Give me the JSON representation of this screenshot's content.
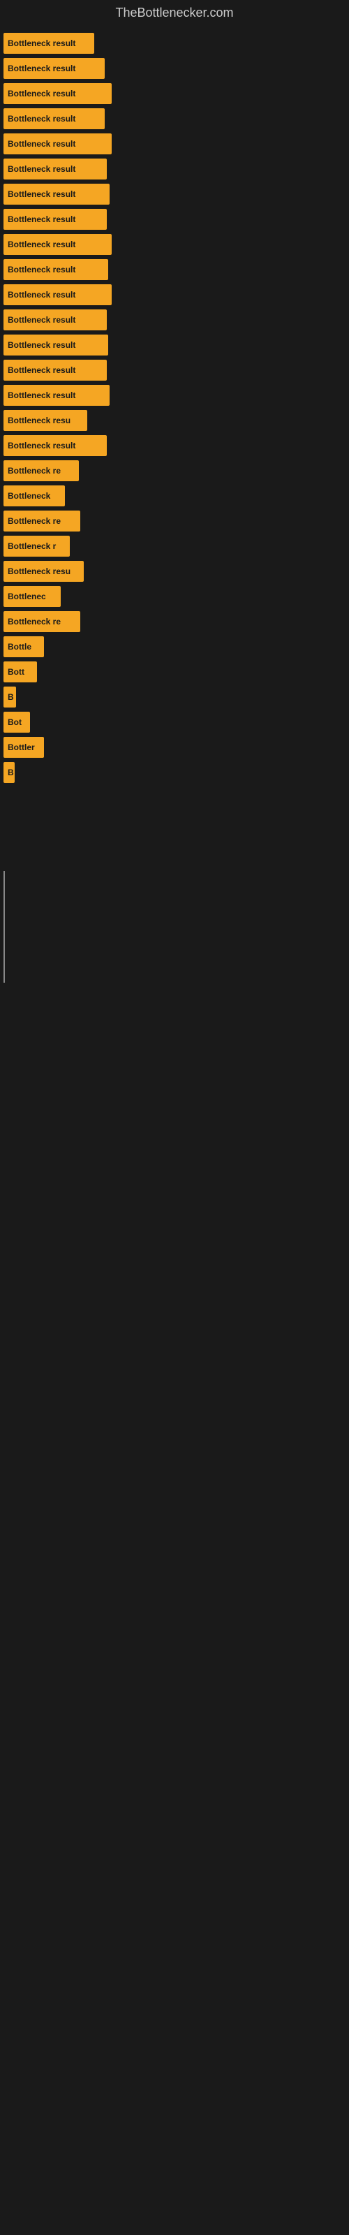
{
  "site": {
    "title": "TheBottlenecker.com"
  },
  "bars": [
    {
      "id": 1,
      "label": "Bottleneck result",
      "class": "bar-1"
    },
    {
      "id": 2,
      "label": "Bottleneck result",
      "class": "bar-2"
    },
    {
      "id": 3,
      "label": "Bottleneck result",
      "class": "bar-3"
    },
    {
      "id": 4,
      "label": "Bottleneck result",
      "class": "bar-4"
    },
    {
      "id": 5,
      "label": "Bottleneck result",
      "class": "bar-5"
    },
    {
      "id": 6,
      "label": "Bottleneck result",
      "class": "bar-6"
    },
    {
      "id": 7,
      "label": "Bottleneck result",
      "class": "bar-7"
    },
    {
      "id": 8,
      "label": "Bottleneck result",
      "class": "bar-8"
    },
    {
      "id": 9,
      "label": "Bottleneck result",
      "class": "bar-9"
    },
    {
      "id": 10,
      "label": "Bottleneck result",
      "class": "bar-10"
    },
    {
      "id": 11,
      "label": "Bottleneck result",
      "class": "bar-11"
    },
    {
      "id": 12,
      "label": "Bottleneck result",
      "class": "bar-12"
    },
    {
      "id": 13,
      "label": "Bottleneck result",
      "class": "bar-13"
    },
    {
      "id": 14,
      "label": "Bottleneck result",
      "class": "bar-14"
    },
    {
      "id": 15,
      "label": "Bottleneck result",
      "class": "bar-15"
    },
    {
      "id": 16,
      "label": "Bottleneck resu",
      "class": "bar-16"
    },
    {
      "id": 17,
      "label": "Bottleneck result",
      "class": "bar-17"
    },
    {
      "id": 18,
      "label": "Bottleneck re",
      "class": "bar-18"
    },
    {
      "id": 19,
      "label": "Bottleneck",
      "class": "bar-19"
    },
    {
      "id": 20,
      "label": "Bottleneck re",
      "class": "bar-20"
    },
    {
      "id": 21,
      "label": "Bottleneck r",
      "class": "bar-21"
    },
    {
      "id": 22,
      "label": "Bottleneck resu",
      "class": "bar-22"
    },
    {
      "id": 23,
      "label": "Bottlenec",
      "class": "bar-23"
    },
    {
      "id": 24,
      "label": "Bottleneck re",
      "class": "bar-24"
    },
    {
      "id": 25,
      "label": "Bottle",
      "class": "bar-25"
    },
    {
      "id": 26,
      "label": "Bott",
      "class": "bar-26"
    },
    {
      "id": 27,
      "label": "B",
      "class": "bar-27"
    },
    {
      "id": 28,
      "label": "Bot",
      "class": "bar-28"
    },
    {
      "id": 29,
      "label": "Bottler",
      "class": "bar-29"
    },
    {
      "id": 30,
      "label": "B",
      "class": "bar-30"
    }
  ],
  "colors": {
    "bar_fill": "#f5a623",
    "bar_text": "#1a1a1a",
    "background": "#1a1a1a",
    "title_text": "#cccccc",
    "line": "#888888"
  }
}
